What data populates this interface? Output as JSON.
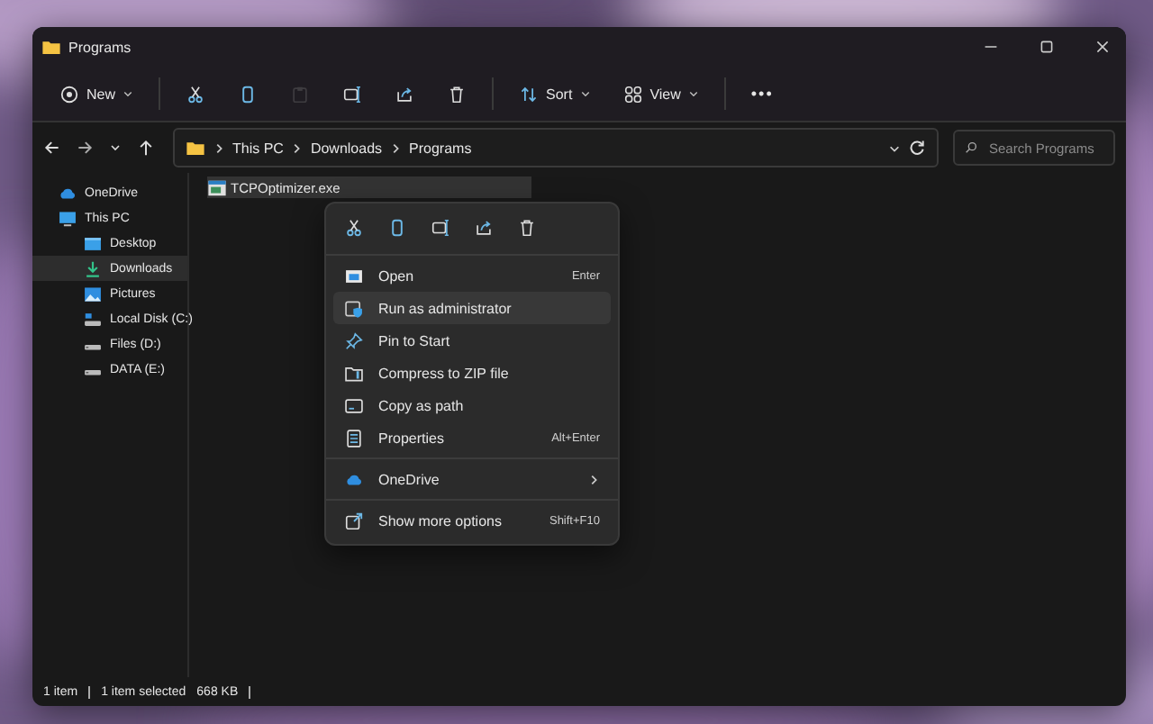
{
  "window": {
    "title": "Programs"
  },
  "toolbar": [
    {
      "kind": "new",
      "label": "New",
      "dropdown": true,
      "disabled": false
    },
    {
      "kind": "cut",
      "disabled": false
    },
    {
      "kind": "copy",
      "disabled": false
    },
    {
      "kind": "paste",
      "disabled": true
    },
    {
      "kind": "rename",
      "disabled": false
    },
    {
      "kind": "share",
      "disabled": false
    },
    {
      "kind": "delete",
      "disabled": false
    },
    {
      "kind": "sort",
      "label": "Sort",
      "dropdown": true,
      "disabled": false
    },
    {
      "kind": "view",
      "label": "View",
      "dropdown": true,
      "disabled": false
    },
    {
      "kind": "more",
      "label": "•••",
      "disabled": false
    }
  ],
  "address": {
    "path": [
      "This PC",
      "Downloads",
      "Programs"
    ]
  },
  "search": {
    "placeholder": "Search Programs"
  },
  "sidebar": {
    "items": [
      {
        "label": "OneDrive",
        "kind": "cloud",
        "selected": false
      },
      {
        "label": "This PC",
        "kind": "pc",
        "selected": false,
        "children": [
          {
            "label": "Desktop",
            "kind": "desktop",
            "selected": false
          },
          {
            "label": "Downloads",
            "kind": "download",
            "selected": true
          },
          {
            "label": "Pictures",
            "kind": "pictures",
            "selected": false
          },
          {
            "label": "Local Disk (C:)",
            "kind": "system-drive",
            "selected": false
          },
          {
            "label": "Files (D:)",
            "kind": "drive",
            "selected": false
          },
          {
            "label": "DATA (E:)",
            "kind": "drive",
            "selected": false
          }
        ]
      }
    ]
  },
  "files": [
    {
      "name": "TCPOptimizer.exe",
      "selected": true
    }
  ],
  "context_menu": {
    "actions": [
      {
        "kind": "cut"
      },
      {
        "kind": "copy"
      },
      {
        "kind": "rename"
      },
      {
        "kind": "share"
      },
      {
        "kind": "delete"
      }
    ],
    "groups": [
      [
        {
          "label": "Open",
          "shortcut": "Enter",
          "kind": "open",
          "selected": false
        },
        {
          "label": "Run as administrator",
          "kind": "admin",
          "selected": true
        },
        {
          "label": "Pin to Start",
          "kind": "pin",
          "selected": false
        },
        {
          "label": "Compress to ZIP file",
          "kind": "zip",
          "selected": false
        },
        {
          "label": "Copy as path",
          "kind": "path",
          "selected": false
        },
        {
          "label": "Properties",
          "shortcut": "Alt+Enter",
          "kind": "properties",
          "selected": false
        }
      ],
      [
        {
          "label": "OneDrive",
          "kind": "cloud",
          "submenu": true,
          "selected": false
        }
      ],
      [
        {
          "label": "Show more options",
          "shortcut": "Shift+F10",
          "kind": "more-options",
          "selected": false
        }
      ]
    ]
  },
  "status_bar": [
    "1 item",
    "1 item selected",
    "668 KB"
  ]
}
